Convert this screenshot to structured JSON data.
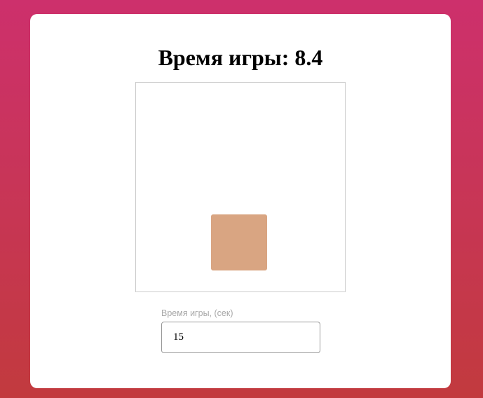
{
  "game": {
    "title_prefix": "Время игры: ",
    "time_left": "8.4",
    "square_color": "#d9a582"
  },
  "settings": {
    "duration_label": "Время игры, (сек)",
    "duration_value": "15"
  }
}
